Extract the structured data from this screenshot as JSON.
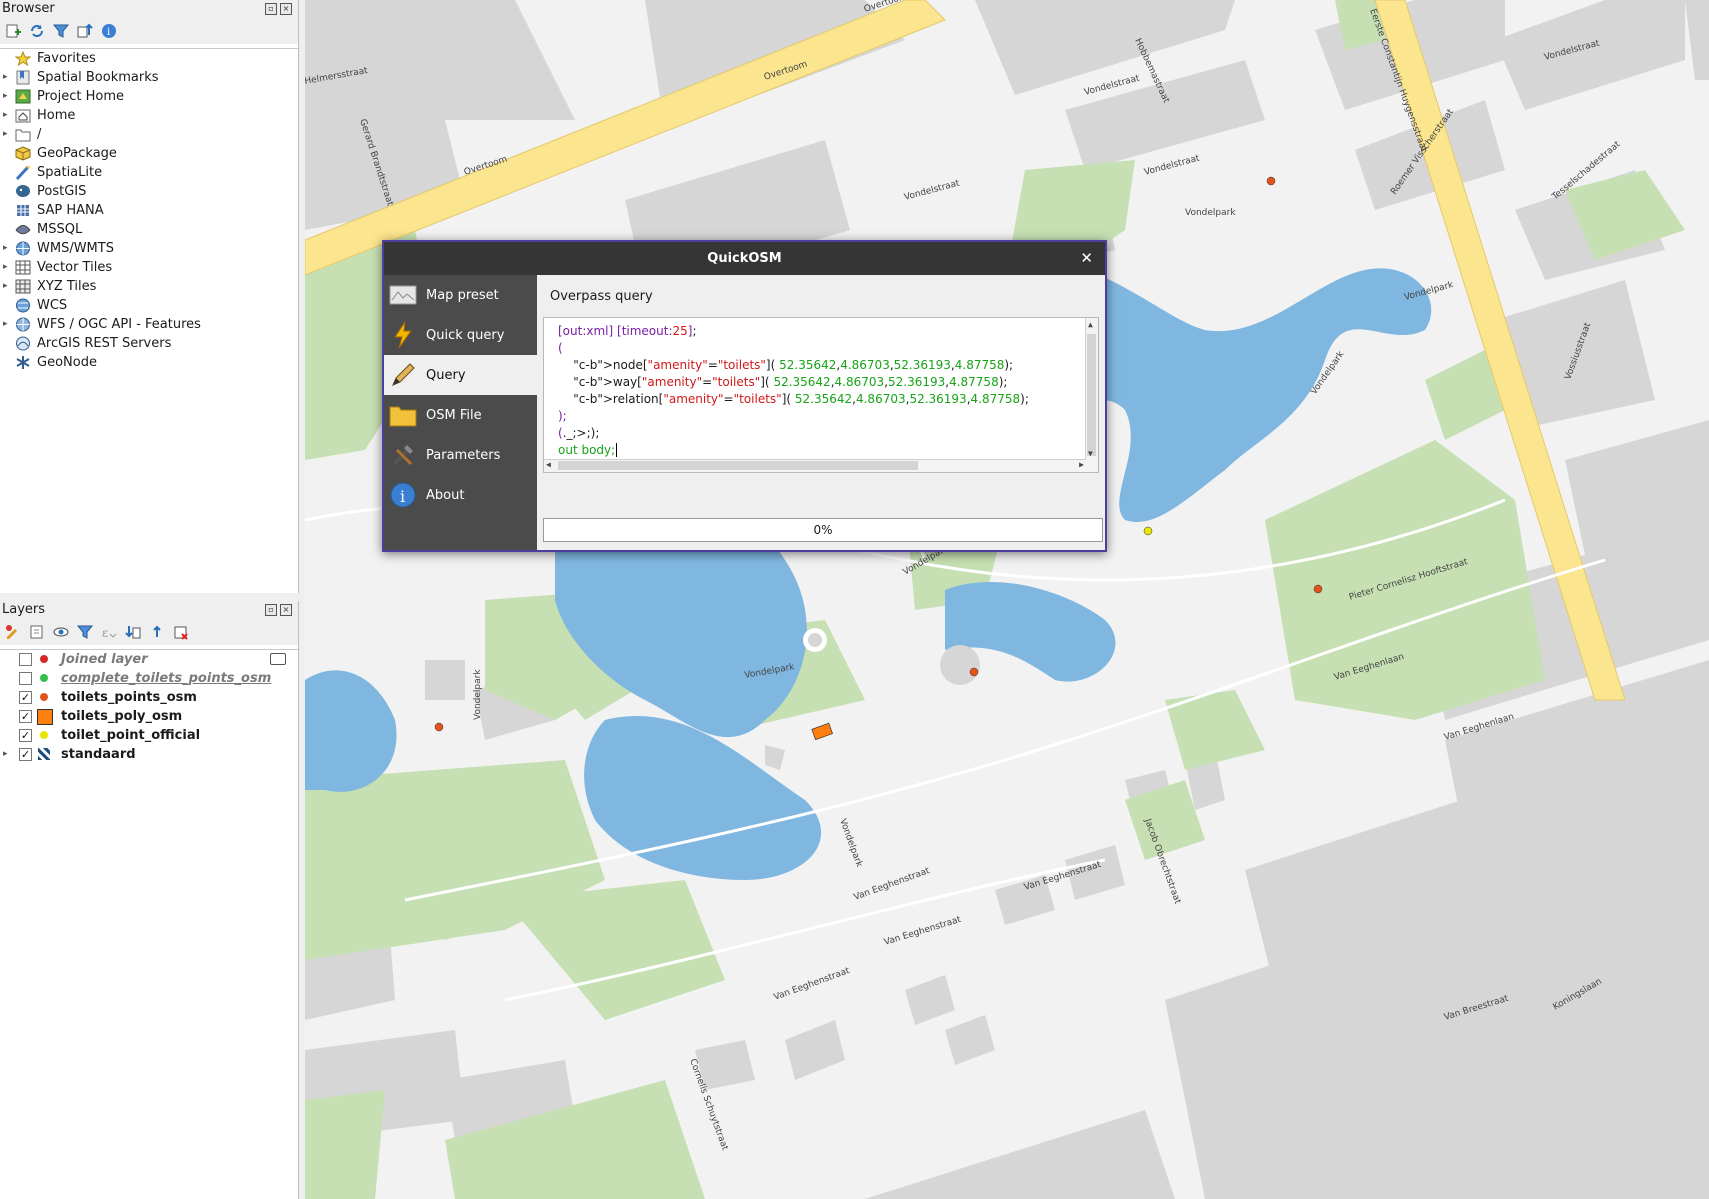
{
  "browser": {
    "title": "Browser",
    "items": [
      {
        "label": "Favorites",
        "icon": "star-icon",
        "expand": false
      },
      {
        "label": "Spatial Bookmarks",
        "icon": "bookmark-icon",
        "expand": true
      },
      {
        "label": "Project Home",
        "icon": "project-home-icon",
        "expand": true
      },
      {
        "label": "Home",
        "icon": "home-folder-icon",
        "expand": true
      },
      {
        "label": "/",
        "icon": "folder-icon",
        "expand": true
      },
      {
        "label": "GeoPackage",
        "icon": "geopackage-icon",
        "expand": false
      },
      {
        "label": "SpatiaLite",
        "icon": "spatialite-icon",
        "expand": false
      },
      {
        "label": "PostGIS",
        "icon": "postgis-icon",
        "expand": false
      },
      {
        "label": "SAP HANA",
        "icon": "sap-hana-icon",
        "expand": false
      },
      {
        "label": "MSSQL",
        "icon": "mssql-icon",
        "expand": false
      },
      {
        "label": "WMS/WMTS",
        "icon": "wms-icon",
        "expand": true
      },
      {
        "label": "Vector Tiles",
        "icon": "vector-tiles-icon",
        "expand": true
      },
      {
        "label": "XYZ Tiles",
        "icon": "xyz-tiles-icon",
        "expand": true
      },
      {
        "label": "WCS",
        "icon": "wcs-icon",
        "expand": false
      },
      {
        "label": "WFS / OGC API - Features",
        "icon": "wfs-icon",
        "expand": true
      },
      {
        "label": "ArcGIS REST Servers",
        "icon": "arcgis-icon",
        "expand": false
      },
      {
        "label": "GeoNode",
        "icon": "geonode-icon",
        "expand": false
      }
    ]
  },
  "layers": {
    "title": "Layers",
    "items": [
      {
        "label": "Joined layer",
        "checked": false,
        "color": "#d62728",
        "style": "off"
      },
      {
        "label": "complete_toilets_points_osm",
        "checked": false,
        "color": "#33c14a",
        "style": "off-under"
      },
      {
        "label": "toilets_points_osm",
        "checked": true,
        "color": "#e3541c",
        "style": "on"
      },
      {
        "label": "toilets_poly_osm",
        "checked": true,
        "color": "#ff7f0e",
        "style": "poly"
      },
      {
        "label": "toilet_point_official",
        "checked": true,
        "color": "#e6e600",
        "style": "on"
      },
      {
        "label": "standaard",
        "checked": true,
        "color": "#1f4e79",
        "style": "raster"
      }
    ]
  },
  "map": {
    "street_labels": [
      "Overtoom",
      "Overtoom",
      "Overtoom",
      "Helmersstraat",
      "Gerard Brandtstraat",
      "Vondelstraat",
      "Vondelstraat",
      "Vondelstraat",
      "Vondelstraat",
      "Vondelpark",
      "Vondelpark",
      "Vondelpark",
      "Vondelpark",
      "Vondelpark",
      "Vondelpark",
      "Vondelpark",
      "Eerste Constantijn Huygensstraat",
      "Roemer Visscherstraat",
      "Pieter Cornelisz Hooftstraat",
      "Van Eeghenlaan",
      "Van Eeghenlaan",
      "Van Eeghenstraat",
      "Van Eeghenstraat",
      "Van Eeghenstraat",
      "Van Eeghenstraat",
      "Jacob Obrechtstraat",
      "Koningslaan",
      "Van Breestraat",
      "Vossiusstraat",
      "Cornelis Schuytstraat",
      "Hobbemastraat",
      "Tesselschadestraat"
    ]
  },
  "dialog": {
    "title": "QuickOSM",
    "nav": [
      {
        "label": "Map preset",
        "icon": "map-preset-icon",
        "active": false
      },
      {
        "label": "Quick query",
        "icon": "lightning-icon",
        "active": false
      },
      {
        "label": "Query",
        "icon": "pencil-icon",
        "active": true
      },
      {
        "label": "OSM File",
        "icon": "folder-icon",
        "active": false
      },
      {
        "label": "Parameters",
        "icon": "tools-icon",
        "active": false
      },
      {
        "label": "About",
        "icon": "info-icon",
        "active": false
      }
    ],
    "section_title": "Overpass query",
    "query": "[out:xml] [timeout:25];\n(\n    node[\"amenity\"=\"toilets\"]( 52.35642,4.86703,52.36193,4.87758);\n    way[\"amenity\"=\"toilets\"]( 52.35642,4.86703,52.36193,4.87758);\n    relation[\"amenity\"=\"toilets\"]( 52.35642,4.86703,52.36193,4.87758);\n);\n(._;>;);\nout body;",
    "progress": "0%"
  }
}
